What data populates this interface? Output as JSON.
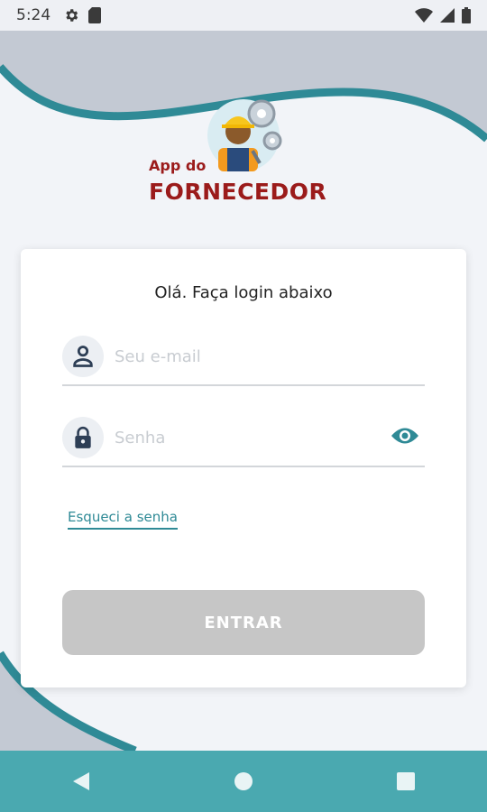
{
  "status_bar": {
    "time": "5:24",
    "left_icons": [
      "gear-icon",
      "sd-card-icon"
    ],
    "right_icons": [
      "wifi-icon",
      "signal-icon",
      "battery-icon"
    ]
  },
  "logo": {
    "line1": "App do",
    "line2": "FORNECEDOR",
    "brand_color": "#9b1b1b"
  },
  "login": {
    "title": "Olá. Faça login abaixo",
    "email_placeholder": "Seu e-mail",
    "email_value": "",
    "password_placeholder": "Senha",
    "password_value": "",
    "forgot_label": "Esqueci a senha",
    "submit_label": "ENTRAR"
  },
  "colors": {
    "accent": "#2f8a96",
    "nav_bar": "#4aa9b0",
    "wave": "#2f8a96",
    "button_disabled": "#c6c6c6"
  },
  "nav": {
    "buttons": [
      "back-icon",
      "home-icon",
      "recents-icon"
    ]
  }
}
